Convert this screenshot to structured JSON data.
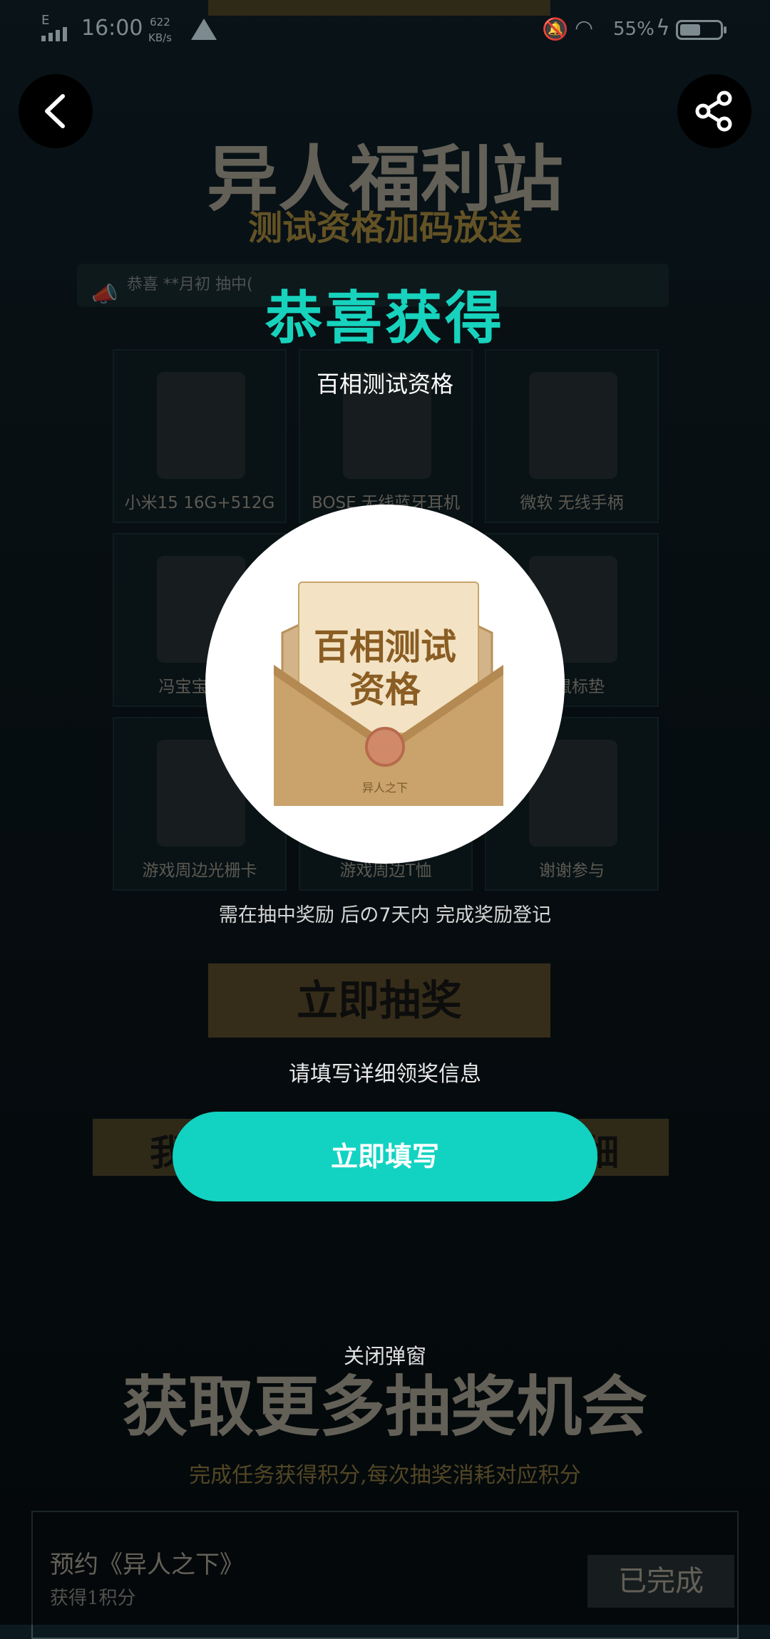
{
  "status_bar": {
    "network": "E",
    "time": "16:00",
    "speed_value": "622",
    "speed_unit": "KB/s",
    "battery": "55%"
  },
  "header": {
    "back_icon": "chevron-left-icon",
    "share_icon": "share-icon"
  },
  "page": {
    "title": "异人福利站",
    "subtitle": "测试资格加码放送",
    "ticker": "恭喜 **月初 抽中(",
    "prizes": [
      {
        "label": "小米15 16G+512G"
      },
      {
        "label": "BOSE 无线蓝牙耳机"
      },
      {
        "label": "微软 无线手柄"
      },
      {
        "label": "冯宝宝冬日"
      },
      {
        "label": ""
      },
      {
        "label": "边鼠标垫"
      },
      {
        "label": "游戏周边光栅卡"
      },
      {
        "label": "游戏周边T恤"
      },
      {
        "label": "谢谢参与"
      }
    ],
    "registration_note": "需在抽中奖励 后の7天内 完成奖励登记",
    "draw_button": "立即抽奖",
    "wide_bar_left": "我",
    "wide_bar_right": "细",
    "more_title": "获取更多抽奖机会",
    "more_subtitle": "完成任务获得积分,每次抽奖消耗对应积分",
    "task_name": "预约《异人之下》",
    "task_points": "获得1积分",
    "task_status": "已完成"
  },
  "popup": {
    "title": "恭喜获得",
    "prize_name": "百相测试资格",
    "prize_image_line1": "百相测试",
    "prize_image_line2": "资格",
    "prize_image_footer": "异人之下",
    "hint": "请填写详细领奖信息",
    "fill_button": "立即填写",
    "close": "关闭弹窗"
  },
  "colors": {
    "accent": "#12d3c1",
    "title_green": "#17d3bd",
    "gold": "#c7a54a"
  }
}
